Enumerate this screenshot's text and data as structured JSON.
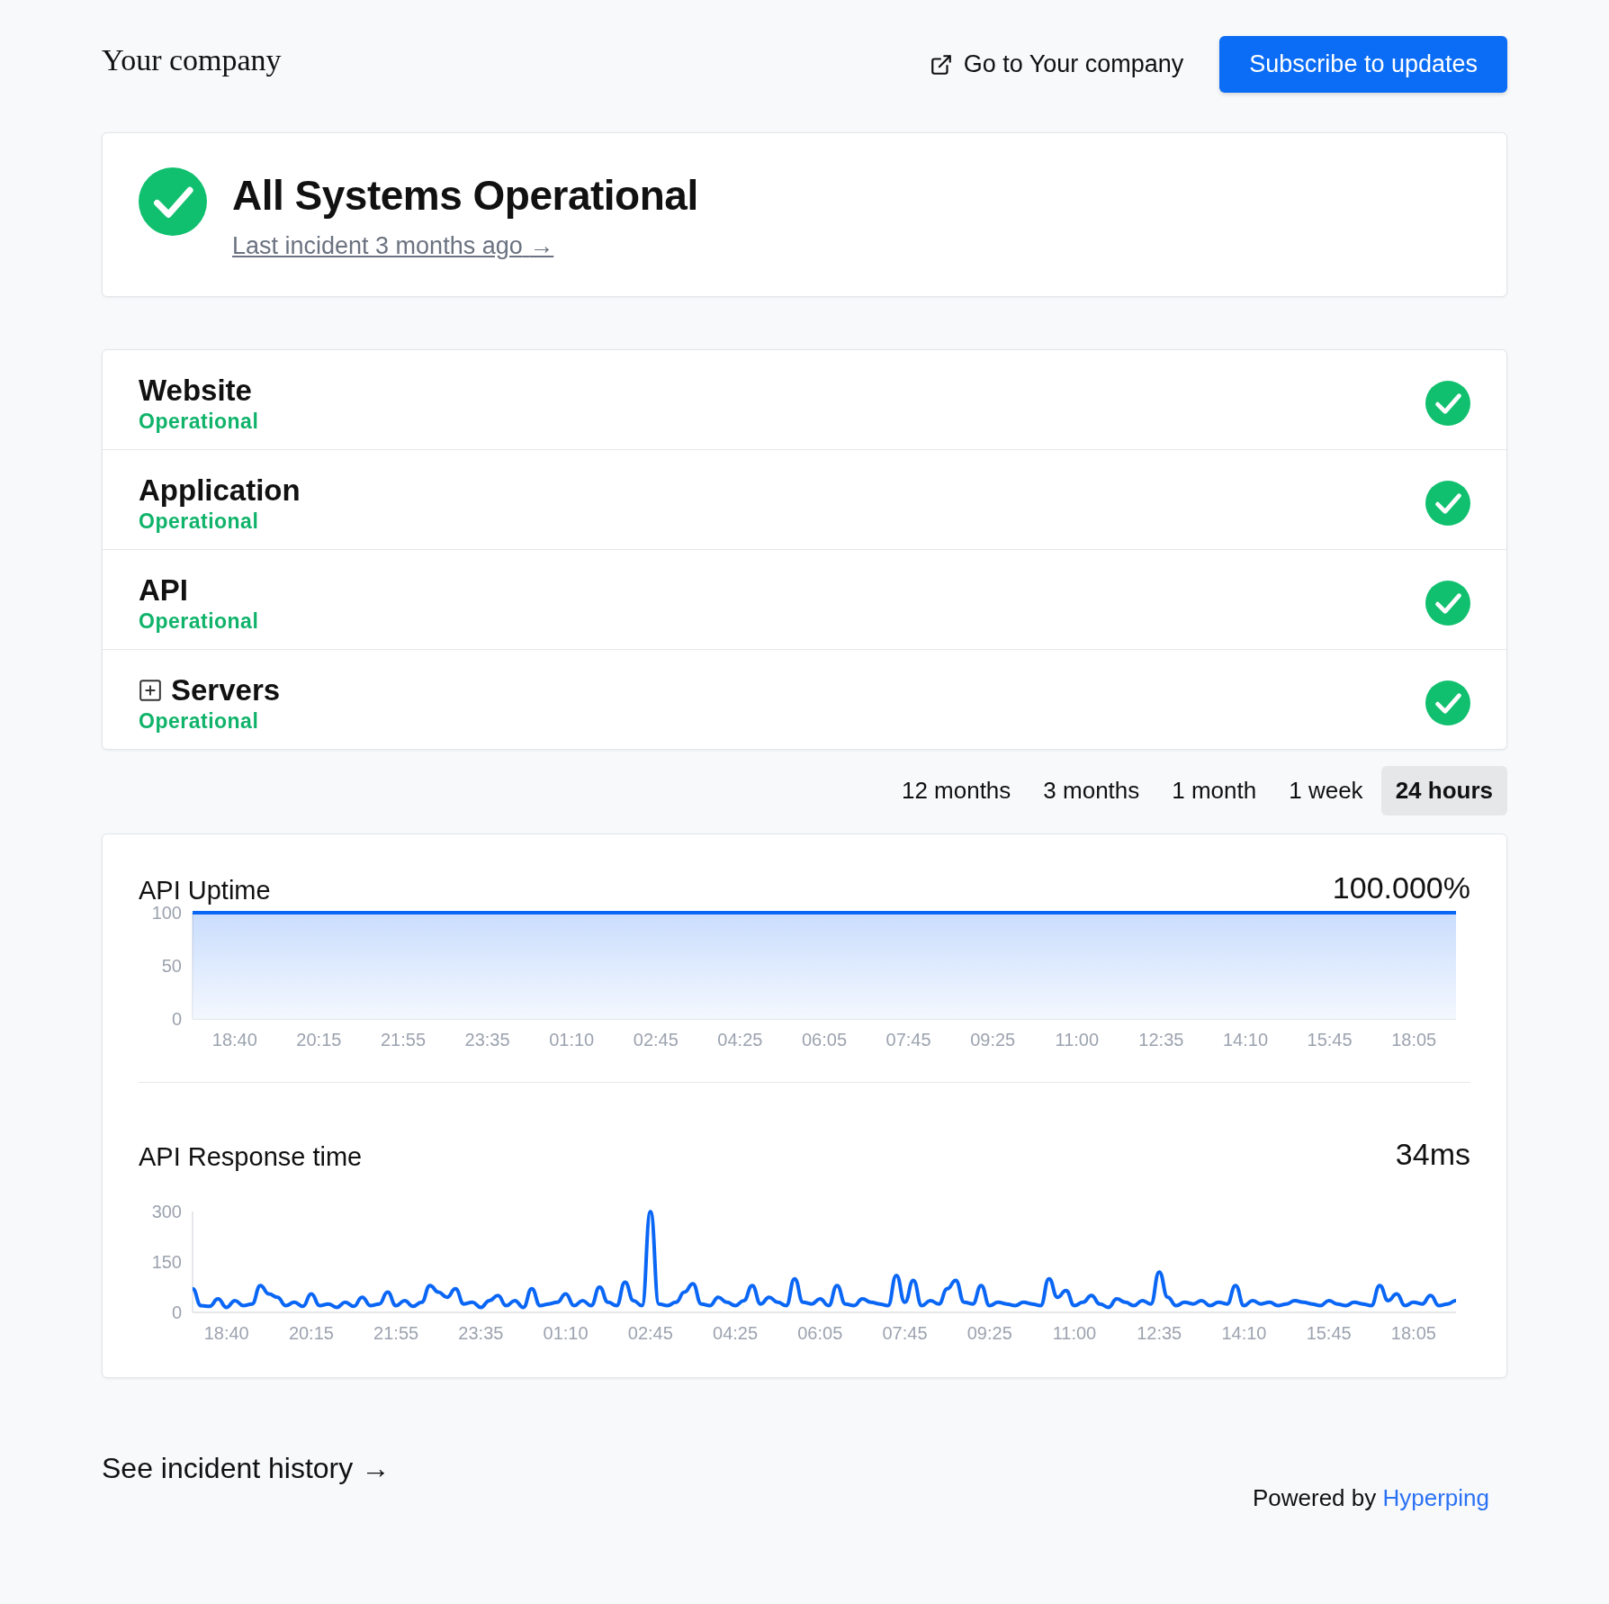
{
  "header": {
    "brand": "Your company",
    "link": "Go to Your company",
    "subscribe": "Subscribe to updates"
  },
  "overall": {
    "title": "All Systems Operational",
    "incident_link": "Last incident 3 months ago",
    "arrow": "→"
  },
  "services": [
    {
      "name": "Website",
      "status": "Operational",
      "kind": "service"
    },
    {
      "name": "Application",
      "status": "Operational",
      "kind": "service"
    },
    {
      "name": "API",
      "status": "Operational",
      "kind": "service"
    },
    {
      "name": "Servers",
      "status": "Operational",
      "kind": "group",
      "expanded": false
    }
  ],
  "ranges": [
    {
      "label": "12 months",
      "selected": false
    },
    {
      "label": "3 months",
      "selected": false
    },
    {
      "label": "1 month",
      "selected": false
    },
    {
      "label": "1 week",
      "selected": false
    },
    {
      "label": "24 hours",
      "selected": true
    }
  ],
  "charts": [
    {
      "value": "100.000%",
      "chart_data": {
        "type": "area",
        "title": "API Uptime",
        "ylim": [
          0,
          100
        ],
        "yticks": [
          0,
          50,
          100
        ],
        "categories": [
          null,
          "18:40",
          null,
          "20:15",
          null,
          "21:55",
          null,
          "23:35",
          null,
          "01:10",
          null,
          "02:45",
          null,
          "04:25",
          null,
          "06:05",
          null,
          "07:45",
          null,
          "09:25",
          null,
          "11:00",
          null,
          "12:35",
          null,
          "14:10",
          null,
          "15:45",
          null,
          "18:05",
          null
        ],
        "series": [
          {
            "color": "#0a66f5",
            "values": [
              100,
              100,
              100,
              100,
              100,
              100,
              100,
              100,
              100,
              100,
              100,
              100,
              100,
              100,
              100,
              100,
              100,
              100,
              100,
              100,
              100,
              100,
              100,
              100,
              100,
              100,
              100,
              100,
              100,
              100,
              100
            ]
          }
        ]
      }
    },
    {
      "value": "34ms",
      "chart_data": {
        "type": "line",
        "title": "API Response time",
        "ylim": [
          0,
          300
        ],
        "yticks": [
          0,
          150,
          300
        ],
        "categories": [
          null,
          null,
          null,
          null,
          "18:40",
          null,
          null,
          null,
          null,
          null,
          null,
          null,
          null,
          null,
          "20:15",
          null,
          null,
          null,
          null,
          null,
          null,
          null,
          null,
          null,
          "21:55",
          null,
          null,
          null,
          null,
          null,
          null,
          null,
          null,
          null,
          "23:35",
          null,
          null,
          null,
          null,
          null,
          null,
          null,
          null,
          null,
          "01:10",
          null,
          null,
          null,
          null,
          null,
          null,
          null,
          null,
          null,
          "02:45",
          null,
          null,
          null,
          null,
          null,
          null,
          null,
          null,
          null,
          "04:25",
          null,
          null,
          null,
          null,
          null,
          null,
          null,
          null,
          null,
          "06:05",
          null,
          null,
          null,
          null,
          null,
          null,
          null,
          null,
          null,
          "07:45",
          null,
          null,
          null,
          null,
          null,
          null,
          null,
          null,
          null,
          "09:25",
          null,
          null,
          null,
          null,
          null,
          null,
          null,
          null,
          null,
          "11:00",
          null,
          null,
          null,
          null,
          null,
          null,
          null,
          null,
          null,
          "12:35",
          null,
          null,
          null,
          null,
          null,
          null,
          null,
          null,
          null,
          "14:10",
          null,
          null,
          null,
          null,
          null,
          null,
          null,
          null,
          null,
          "15:45",
          null,
          null,
          null,
          null,
          null,
          null,
          null,
          null,
          null,
          "18:05",
          null,
          null,
          null,
          null,
          null
        ],
        "series": [
          {
            "color": "#0a66f5",
            "values": [
              70,
              20,
              18,
              40,
              15,
              35,
              20,
              25,
              80,
              55,
              45,
              20,
              30,
              18,
              55,
              20,
              25,
              15,
              30,
              18,
              45,
              20,
              25,
              60,
              20,
              35,
              18,
              30,
              80,
              60,
              45,
              70,
              25,
              30,
              15,
              35,
              50,
              20,
              35,
              15,
              70,
              20,
              25,
              30,
              55,
              20,
              35,
              20,
              75,
              30,
              20,
              90,
              35,
              20,
              300,
              25,
              20,
              30,
              60,
              85,
              25,
              20,
              45,
              30,
              20,
              35,
              80,
              25,
              45,
              30,
              20,
              100,
              30,
              25,
              40,
              20,
              80,
              25,
              20,
              40,
              30,
              25,
              20,
              110,
              30,
              95,
              20,
              35,
              25,
              70,
              95,
              30,
              25,
              80,
              20,
              30,
              25,
              20,
              30,
              25,
              20,
              100,
              45,
              65,
              20,
              30,
              50,
              25,
              15,
              40,
              30,
              20,
              35,
              25,
              120,
              45,
              20,
              30,
              25,
              35,
              20,
              30,
              25,
              80,
              20,
              35,
              25,
              30,
              20,
              25,
              35,
              30,
              25,
              20,
              35,
              25,
              20,
              30,
              25,
              20,
              80,
              35,
              55,
              20,
              30,
              25,
              50,
              20,
              25,
              35
            ]
          }
        ]
      }
    }
  ],
  "footer": {
    "history": "See incident history",
    "arrow": "→",
    "powered": "Powered by",
    "brand": "Hyperping"
  }
}
